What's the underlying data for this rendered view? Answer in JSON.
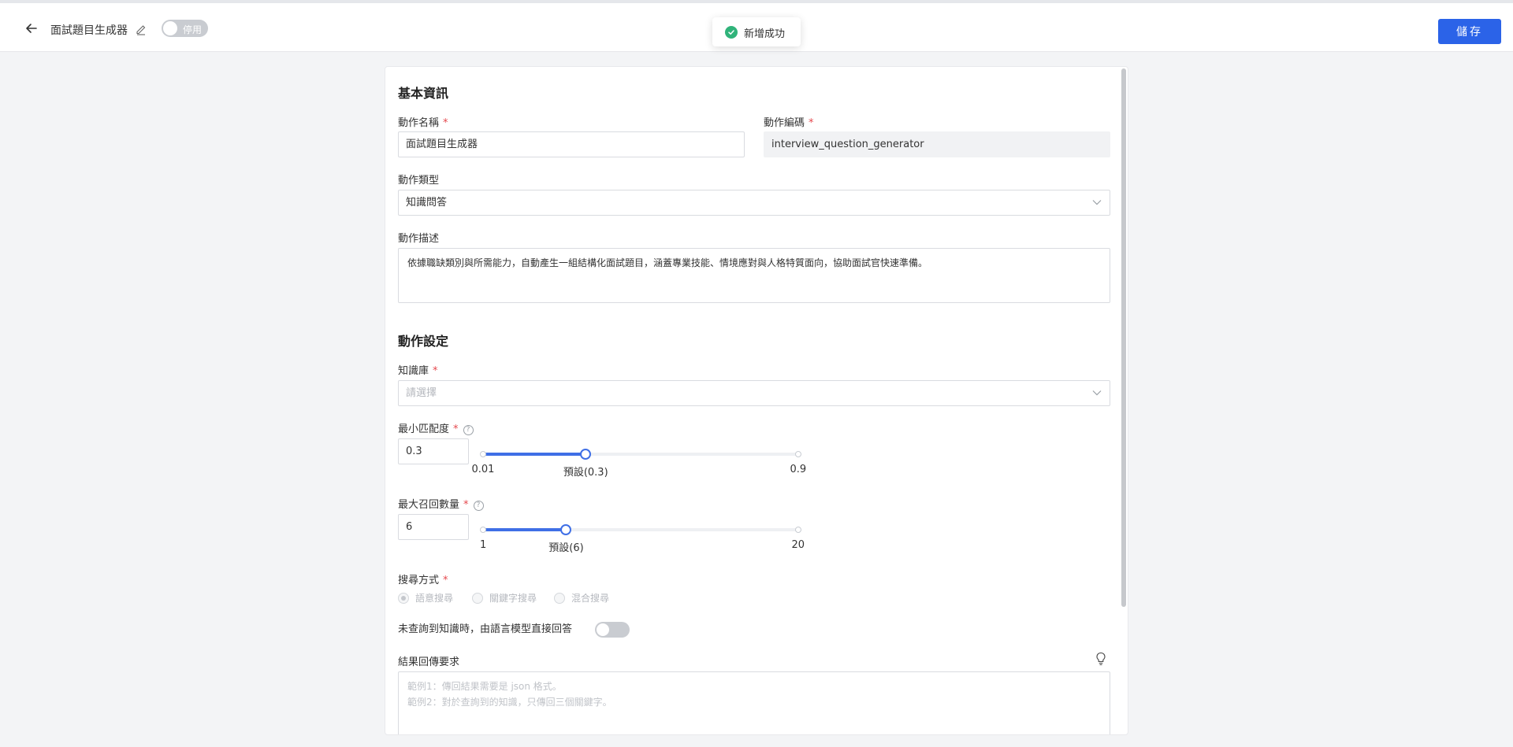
{
  "header": {
    "title": "面試題目生成器",
    "status_toggle_label": "停用",
    "save_label": "儲存"
  },
  "toast": {
    "message": "新增成功"
  },
  "basic": {
    "section_title": "基本資訊",
    "name_label": "動作名稱",
    "name_value": "面試題目生成器",
    "code_label": "動作編碼",
    "code_value": "interview_question_generator",
    "type_label": "動作類型",
    "type_value": "知識問答",
    "desc_label": "動作描述",
    "desc_value": "依據職缺類別與所需能力，自動產生一組結構化面試題目，涵蓋專業技能、情境應對與人格特質面向，協助面試官快速準備。"
  },
  "settings": {
    "section_title": "動作設定",
    "kb_label": "知識庫",
    "kb_placeholder": "請選擇",
    "min_match": {
      "label": "最小匹配度",
      "value": "0.3",
      "min": 0.01,
      "max": 0.9,
      "default": 0.3,
      "min_label": "0.01",
      "default_label": "預設(0.3)",
      "max_label": "0.9"
    },
    "max_recall": {
      "label": "最大召回數量",
      "value": "6",
      "min": 1,
      "max": 20,
      "default": 6,
      "min_label": "1",
      "default_label": "預設(6)",
      "max_label": "20"
    },
    "search_label": "搜尋方式",
    "search_options": [
      "語意搜尋",
      "關鍵字搜尋",
      "混合搜尋"
    ],
    "search_selected": 0,
    "fallback_label": "未查詢到知識時，由語言模型直接回答",
    "fallback_enabled": false,
    "result_label": "結果回傳要求",
    "result_placeholder_1": "範例1：傳回結果需要是 json 格式。",
    "result_placeholder_2": "範例2：對於查詢到的知識，只傳回三個關鍵字。"
  },
  "icons": {
    "back": "arrow-left-icon",
    "edit": "pencil-icon",
    "success": "check-circle-icon",
    "dropdown": "chevron-down-icon",
    "help": "question-circle-icon",
    "hint": "lightbulb-icon"
  },
  "colors": {
    "primary": "#2b63e8",
    "success": "#30b37a",
    "required": "#e5484d"
  }
}
